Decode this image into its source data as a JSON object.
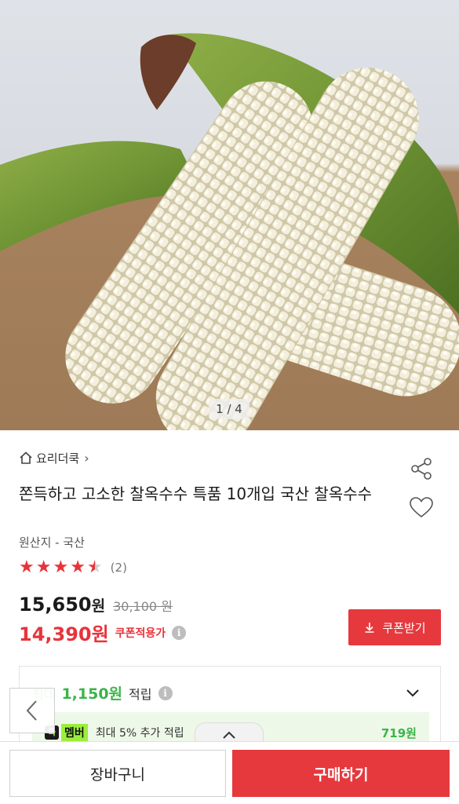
{
  "hero": {
    "pager": "1 / 4"
  },
  "store": {
    "name": "요리더쿡",
    "chevron": "›"
  },
  "product": {
    "title": "쫀득하고 고소한 찰옥수수 특품 10개입 국산 찰옥수수",
    "origin": "원산지 - 국산",
    "rating": 4.5,
    "review_count": "(2)",
    "price": "15,650",
    "price_unit": "원",
    "original_price": "30,100 원",
    "coupon_price": "14,390원",
    "coupon_applied_label": "쿠폰적용가",
    "coupon_button": "쿠폰받기"
  },
  "points": {
    "max_label": "최대",
    "amount": "1,150원",
    "earn_label": "적립",
    "member_logo": "쿡",
    "member_tag": "멤버",
    "member_text": "최대 5% 추가 적립",
    "member_value": "719원"
  },
  "bottom": {
    "cart": "장바구니",
    "buy": "구매하기"
  },
  "colors": {
    "accent": "#e5393e",
    "green": "#3cb44a",
    "member_green": "#9bef3c"
  },
  "icons": [
    "home-icon",
    "share-icon",
    "heart-icon",
    "info-icon",
    "download-icon",
    "chevron-down-icon",
    "chevron-left-icon",
    "chevron-up-icon"
  ]
}
